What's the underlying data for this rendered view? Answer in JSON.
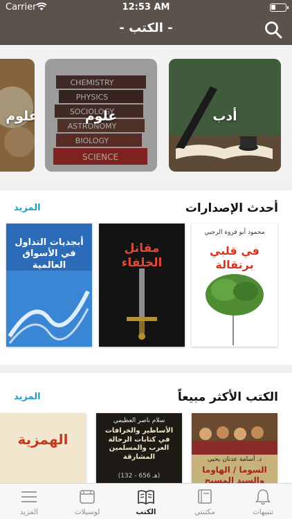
{
  "status_bar": {
    "carrier": "Carrier",
    "time": "12:53 AM"
  },
  "header": {
    "title": "- الكتب -"
  },
  "categories": [
    {
      "label": "أدب"
    },
    {
      "label": "علوم"
    },
    {
      "label": "علوم"
    }
  ],
  "science_book_spines": [
    "CHEMISTRY",
    "PHYSICS",
    "SOCIOLOGY",
    "ASTRONOMY",
    "BIOLOGY",
    "SCIENCE"
  ],
  "latest": {
    "title": "أحدث الإصدارات",
    "more": "المزيد",
    "books": [
      {
        "author": "محمود أبو فروة الرجبي",
        "title": "في قلبي برتقالة"
      },
      {
        "title": "مقاتل الخلفاء"
      },
      {
        "title": "أبجديات التداول في الأسواق العالمية"
      }
    ]
  },
  "bestsellers": {
    "title": "الكتب الأكثر مبيعاً",
    "more": "المزيد",
    "books": [
      {
        "author": "د. أسامة عدنان يحيى",
        "title": "السوما / الهاوما والسيد المسيح"
      },
      {
        "author": "سلام ناصر العظيمي",
        "title": "الأساطير والخرافات في كتابات الرحالة العرب والمسلمين المشارقة",
        "years": "(132 - 656 هـ)"
      },
      {
        "title": "الهمزية"
      }
    ]
  },
  "tabbar": {
    "tabs": [
      {
        "label": "تنبيهات",
        "icon": "bell-icon"
      },
      {
        "label": "مكتبتي",
        "icon": "library-icon"
      },
      {
        "label": "الكتب",
        "icon": "books-icon",
        "active": true
      },
      {
        "label": "لوسيلات",
        "icon": "media-icon"
      },
      {
        "label": "المزيد",
        "icon": "menu-icon"
      }
    ]
  },
  "colors": {
    "header": "#5b524c",
    "accent": "#1aa0c8",
    "tab_inactive": "#8e8e93"
  }
}
